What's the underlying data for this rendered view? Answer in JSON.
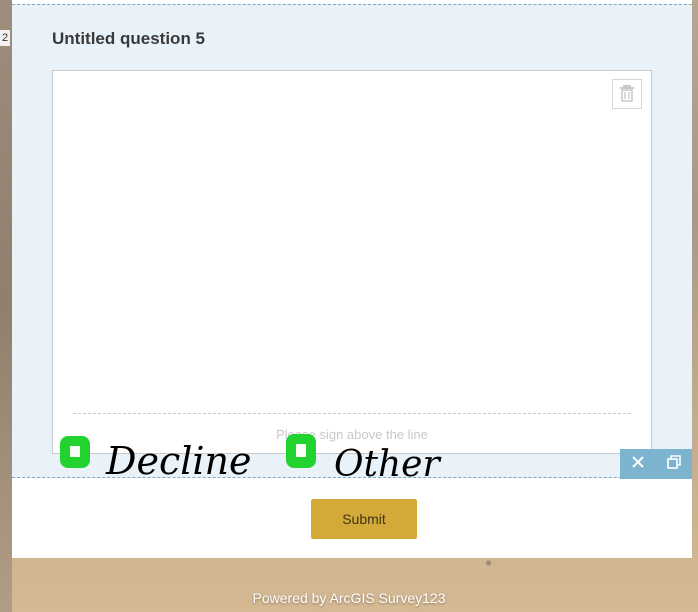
{
  "left_strip_number": "2",
  "question": {
    "title": "Untitled question 5",
    "signature_hint": "Please sign above the line"
  },
  "handwritten_options": {
    "option_1": "Decline",
    "option_2": "Other"
  },
  "submit_label": "Submit",
  "footer": "Powered by ArcGIS Survey123",
  "colors": {
    "question_bg": "#eaf2f9",
    "submit_bg": "#d3aa3a",
    "panel_control_bg": "#7cb4cf",
    "checkbox_green": "#22d22f"
  },
  "icons": {
    "trash": "trash-icon",
    "close": "close-icon",
    "restore": "restore-icon"
  }
}
